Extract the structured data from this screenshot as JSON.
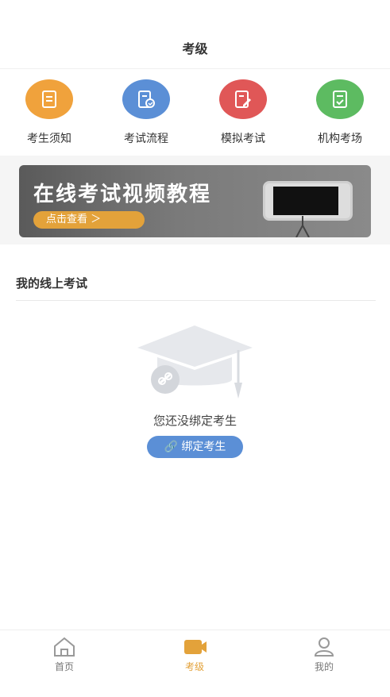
{
  "header": {
    "title": "考级"
  },
  "quick_links": [
    {
      "label": "考生须知",
      "color": "#f0a23c",
      "icon": "document-icon"
    },
    {
      "label": "考试流程",
      "color": "#5b8fd6",
      "icon": "process-icon"
    },
    {
      "label": "模拟考试",
      "color": "#e05757",
      "icon": "edit-icon"
    },
    {
      "label": "机构考场",
      "color": "#5dbb61",
      "icon": "checklist-icon"
    }
  ],
  "banner": {
    "title": "在线考试视频教程",
    "button": "点击查看 ＞"
  },
  "my_exams": {
    "title": "我的线上考试",
    "empty_text": "您还没绑定考生",
    "bind_button": "绑定考生"
  },
  "tabbar": {
    "items": [
      {
        "label": "首页",
        "icon": "home-icon",
        "active": false
      },
      {
        "label": "考级",
        "icon": "camera-icon",
        "active": true
      },
      {
        "label": "我的",
        "icon": "user-icon",
        "active": false
      }
    ],
    "active_color": "#e3a23a",
    "inactive_color": "#777777"
  }
}
